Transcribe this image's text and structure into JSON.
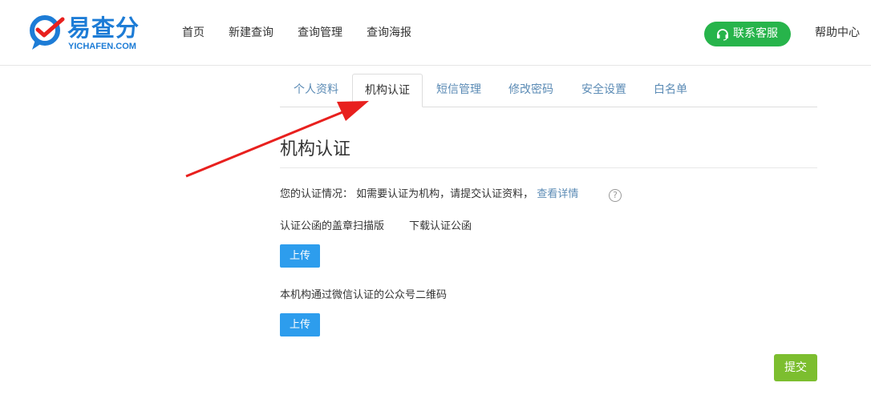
{
  "header": {
    "logo_brand": "易查分",
    "logo_domain": "YICHAFEN.COM",
    "nav": [
      "首页",
      "新建查询",
      "查询管理",
      "查询海报"
    ],
    "contact_button": "联系客服",
    "help_link": "帮助中心"
  },
  "tabs": [
    "个人资料",
    "机构认证",
    "短信管理",
    "修改密码",
    "安全设置",
    "白名单"
  ],
  "active_tab": "机构认证",
  "section": {
    "title": "机构认证",
    "status_label": "您的认证情况：",
    "status_text": "如需要认证为机构，请提交认证资料，",
    "status_link": "查看详情",
    "help_icon": "?",
    "letter_label": "认证公函的盖章扫描版",
    "letter_download": "下载认证公函",
    "upload_label": "上传",
    "qrcode_label": "本机构通过微信认证的公众号二维码",
    "submit_label": "提交"
  },
  "colors": {
    "brand_blue": "#1d7cd6",
    "link_blue": "#5b8bb5",
    "contact_green": "#27b44b",
    "upload_blue": "#2d9ded",
    "submit_green": "#7cbe2f",
    "annotation_red": "#e8201e"
  },
  "icons": {
    "logo": "checkmark-chat-bubble-icon",
    "contact": "headset-icon",
    "help": "question-circle-icon",
    "annotation": "red-arrow"
  }
}
